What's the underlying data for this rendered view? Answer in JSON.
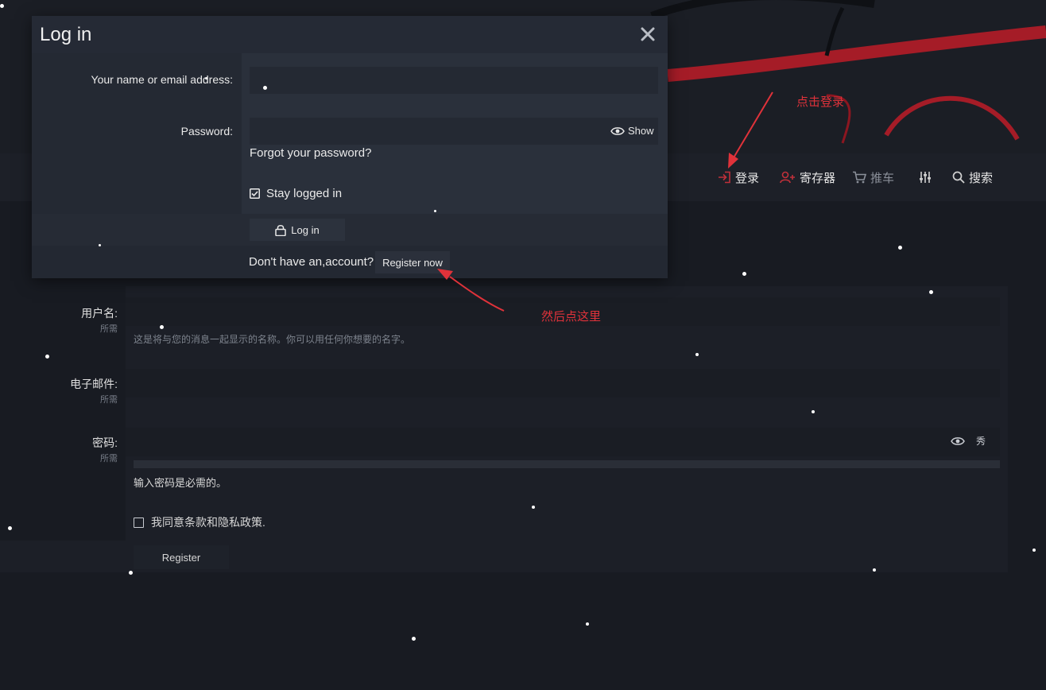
{
  "nav": {
    "login_label": "登录",
    "register_label": "寄存器",
    "cart_label": "推车",
    "search_label": "搜索"
  },
  "modal": {
    "title": "Log in",
    "username_label": "Your name or email address:",
    "password_label": "Password:",
    "show_label": "Show",
    "forgot_label": "Forgot your password?",
    "stay_label": "Stay logged in",
    "login_button": "Log in",
    "no_account_text": "Don't have an,account?",
    "register_button": "Register now"
  },
  "register_form": {
    "username_label": "用户名:",
    "username_required": "所需",
    "username_hint": "这是将与您的消息一起显示的名称。你可以用任何你想要的名字。",
    "email_label": "电子邮件:",
    "email_required": "所需",
    "password_label": "密码:",
    "password_required": "所需",
    "password_show": "秀",
    "password_error": "输入密码是必需的。",
    "agree_label": "我同意条款和隐私政策.",
    "submit_button": "Register"
  },
  "annotations": {
    "click_login": "点击登录",
    "then_click_here": "然后点这里"
  },
  "colors": {
    "background": "#181b22",
    "modal_bg": "#252a35",
    "annotation_red": "#e0323a",
    "banner_accent": "#b31d28"
  }
}
